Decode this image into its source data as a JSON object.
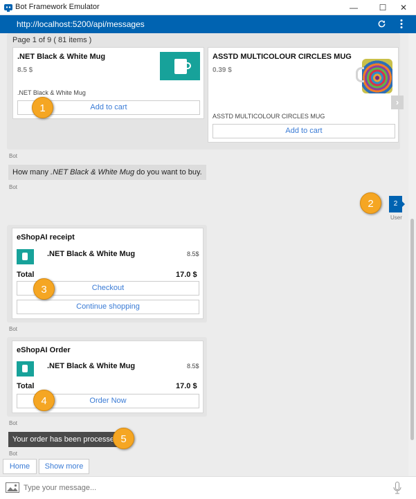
{
  "window": {
    "title": "Bot Framework Emulator",
    "minimize": "—",
    "maximize": "☐",
    "close": "✕"
  },
  "address": {
    "url": "http://localhost:5200/api/messages",
    "refresh_icon": "refresh-icon",
    "menu_icon": "kebab-menu-icon"
  },
  "carousel": {
    "page_info": "Page 1 of 9 ( 81 items )",
    "items": [
      {
        "title": ".NET Black & White Mug",
        "price": "8.5 $",
        "subtitle": ".NET Black & White Mug",
        "button": "Add to cart"
      },
      {
        "title": "ASSTD MULTICOLOUR CIRCLES MUG",
        "price": "0.39 $",
        "subtitle": "ASSTD MULTICOLOUR CIRCLES MUG",
        "button": "Add to cart"
      }
    ],
    "sender": "Bot"
  },
  "question": {
    "prefix": "How many ",
    "item": ".NET Black & White Mug",
    "suffix": " do you want to buy.",
    "sender": "Bot"
  },
  "user_reply": {
    "text": "2",
    "sender": "User"
  },
  "receipt": {
    "title": "eShopAI receipt",
    "item_name": ".NET Black & White Mug",
    "item_price": "8.5$",
    "total_label": "Total",
    "total_value": "17.0 $",
    "checkout": "Checkout",
    "continue": "Continue shopping",
    "sender": "Bot"
  },
  "order": {
    "title": "eShopAI Order",
    "item_name": ".NET Black & White Mug",
    "item_price": "8.5$",
    "total_label": "Total",
    "total_value": "17.0 $",
    "order_now": "Order Now",
    "sender": "Bot"
  },
  "processed": {
    "text": "Your order has been processed.",
    "sender": "Bot"
  },
  "suggested_actions": [
    "Home",
    "Show more"
  ],
  "markers": [
    "1",
    "2",
    "3",
    "4",
    "5"
  ],
  "input": {
    "placeholder": "Type your message..."
  },
  "colors": {
    "accent": "#0063b1",
    "marker": "#f5a623",
    "link": "#3a7bd5"
  }
}
